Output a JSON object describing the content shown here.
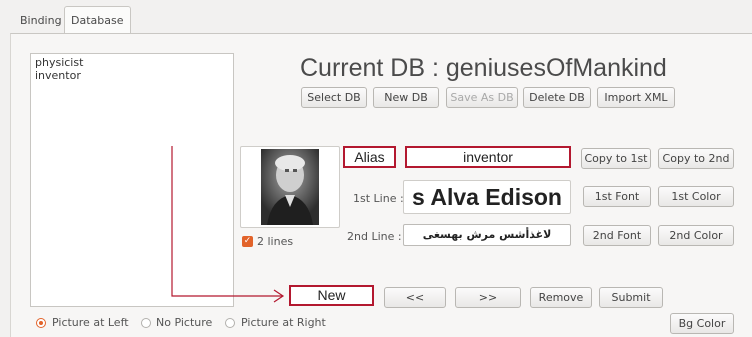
{
  "tabs": [
    {
      "label": "Binding",
      "active": false
    },
    {
      "label": "Database",
      "active": true
    }
  ],
  "list": {
    "items": [
      "physicist",
      "inventor"
    ]
  },
  "header": {
    "title": "Current DB : geniusesOfMankind"
  },
  "db_buttons": {
    "select_db": "Select DB",
    "new_db": "New DB",
    "save_as_db": "Save As DB",
    "delete_db": "Delete DB",
    "import_xml": "Import XML"
  },
  "form": {
    "alias_label": "Alias",
    "alias_value": "inventor",
    "first_line_label": "1st Line :",
    "first_line_value": "s Alva Edison",
    "second_line_label": "2nd Line :",
    "second_line_value": "لاغذأشس مرش بهسغى",
    "copy_to_1st": "Copy to 1st",
    "copy_to_2nd": "Copy to 2nd",
    "first_font": "1st Font",
    "first_color": "1st Color",
    "second_font": "2nd Font",
    "second_color": "2nd Color",
    "two_lines_label": "2 lines",
    "two_lines_checked": true
  },
  "nav": {
    "new_label": "New",
    "prev": "<<",
    "next": ">>",
    "remove": "Remove",
    "submit": "Submit"
  },
  "picture_options": {
    "left": "Picture at Left",
    "none": "No Picture",
    "right": "Picture at Right",
    "selected": "left"
  },
  "bg_color": "Bg Color",
  "colors": {
    "accent": "#e2632a",
    "highlight": "#b3182f"
  }
}
